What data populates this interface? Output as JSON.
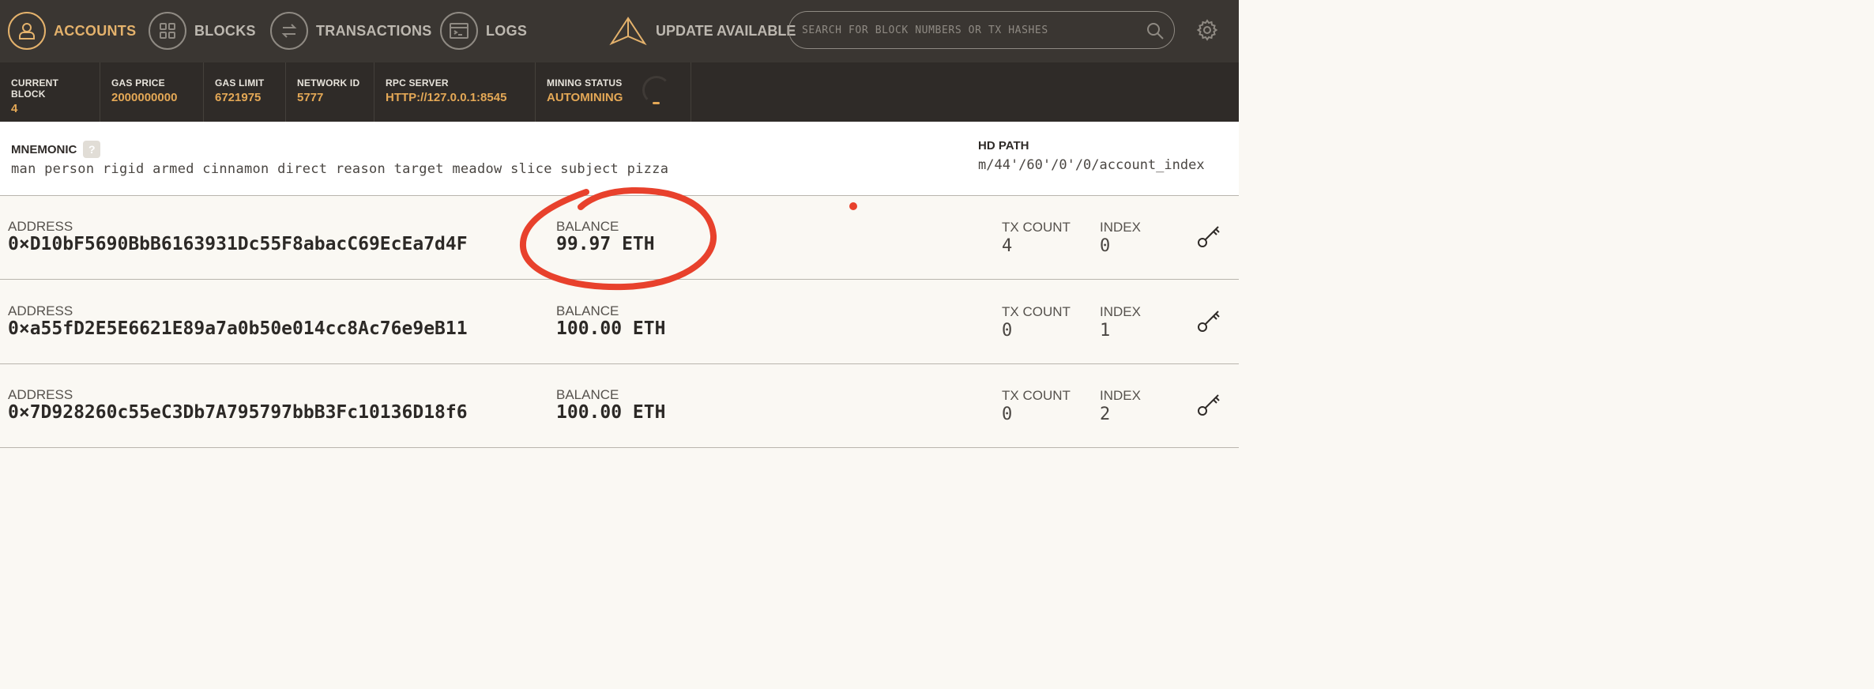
{
  "nav": {
    "items": [
      {
        "label": "ACCOUNTS",
        "icon": "user-icon",
        "active": true
      },
      {
        "label": "BLOCKS",
        "icon": "blocks-grid-icon",
        "active": false
      },
      {
        "label": "TRANSACTIONS",
        "icon": "transfer-arrows-icon",
        "active": false
      },
      {
        "label": "LOGS",
        "icon": "terminal-window-icon",
        "active": false
      }
    ],
    "update_label": "UPDATE AVAILABLE",
    "search_placeholder": "SEARCH FOR BLOCK NUMBERS OR TX HASHES"
  },
  "status": {
    "items": [
      {
        "label": "CURRENT BLOCK",
        "value": "4"
      },
      {
        "label": "GAS PRICE",
        "value": "2000000000"
      },
      {
        "label": "GAS LIMIT",
        "value": "6721975"
      },
      {
        "label": "NETWORK ID",
        "value": "5777"
      },
      {
        "label": "RPC SERVER",
        "value": "HTTP://127.0.0.1:8545"
      },
      {
        "label": "MINING STATUS",
        "value": "AUTOMINING"
      }
    ]
  },
  "mnemonic": {
    "label": "MNEMONIC",
    "help": "?",
    "words": "man person rigid armed cinnamon direct reason target meadow slice subject pizza",
    "hd_label": "HD PATH",
    "hd_path": "m/44'/60'/0'/0/account_index"
  },
  "labels": {
    "address": "ADDRESS",
    "balance": "BALANCE",
    "tx_count": "TX COUNT",
    "index": "INDEX"
  },
  "accounts": [
    {
      "address": "0×D10bF5690BbB6163931Dc55F8abacC69EcEa7d4F",
      "balance": "99.97 ETH",
      "tx_count": "4",
      "index": "0"
    },
    {
      "address": "0×a55fD2E5E6621E89a7a0b50e014cc8Ac76e9eB11",
      "balance": "100.00 ETH",
      "tx_count": "0",
      "index": "1"
    },
    {
      "address": "0×7D928260c55eC3Db7A795797bbB3Fc10136D18f6",
      "balance": "100.00 ETH",
      "tx_count": "0",
      "index": "2"
    }
  ],
  "colors": {
    "accent": "#e4b26c",
    "nav_bg": "#3a3632",
    "status_bg": "#2f2b28",
    "annotation": "#e8412c"
  }
}
